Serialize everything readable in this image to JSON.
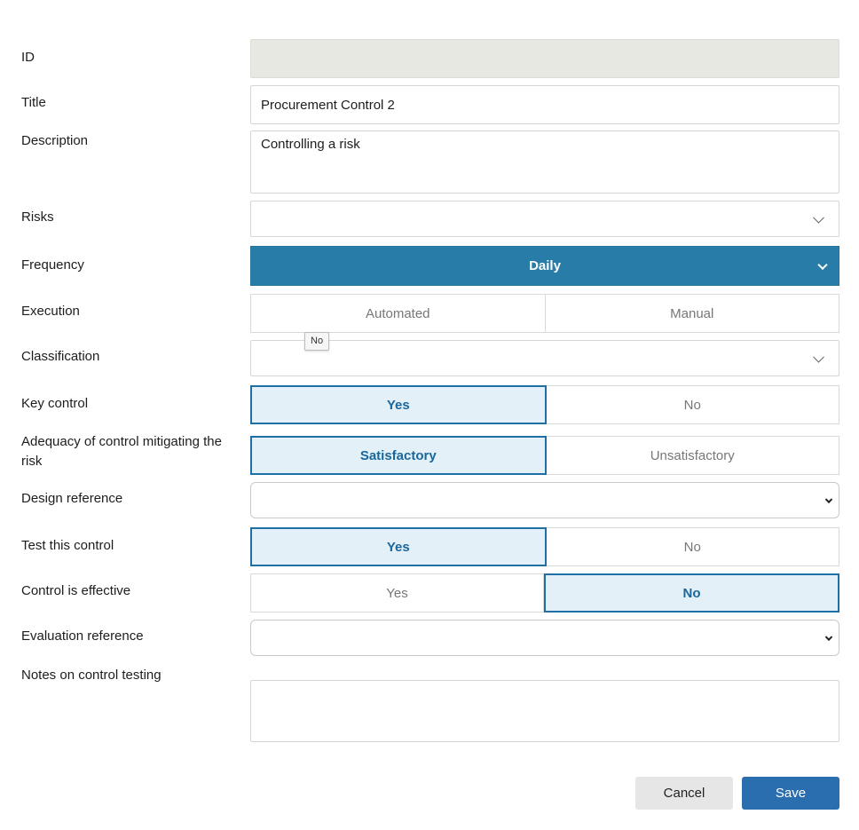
{
  "fields": {
    "id": {
      "label": "ID",
      "value": ""
    },
    "title": {
      "label": "Title",
      "value": "Procurement Control 2"
    },
    "description": {
      "label": "Description",
      "value": "Controlling a risk"
    },
    "risks": {
      "label": "Risks",
      "value": ""
    },
    "frequency": {
      "label": "Frequency",
      "value": "Daily"
    },
    "execution": {
      "label": "Execution",
      "options": [
        "Automated",
        "Manual"
      ],
      "selected": null
    },
    "classification": {
      "label": "Classification",
      "value": ""
    },
    "key_control": {
      "label": "Key control",
      "options": [
        "Yes",
        "No"
      ],
      "selected": "Yes"
    },
    "adequacy": {
      "label": "Adequacy of control mitigating the risk",
      "options": [
        "Satisfactory",
        "Unsatisfactory"
      ],
      "selected": "Satisfactory"
    },
    "design_reference": {
      "label": "Design reference",
      "value": ""
    },
    "test_control": {
      "label": "Test this control",
      "options": [
        "Yes",
        "No"
      ],
      "selected": "Yes"
    },
    "effective": {
      "label": "Control is effective",
      "options": [
        "Yes",
        "No"
      ],
      "selected": "No"
    },
    "evaluation_reference": {
      "label": "Evaluation reference",
      "value": ""
    },
    "notes": {
      "label": "Notes on control testing",
      "value": ""
    }
  },
  "tooltip": "No",
  "buttons": {
    "cancel": "Cancel",
    "save": "Save"
  },
  "colors": {
    "accent": "#287da8",
    "save": "#2a6eb0",
    "selected_bg": "#e3f0f8",
    "selected_border": "#1f6fa6"
  }
}
